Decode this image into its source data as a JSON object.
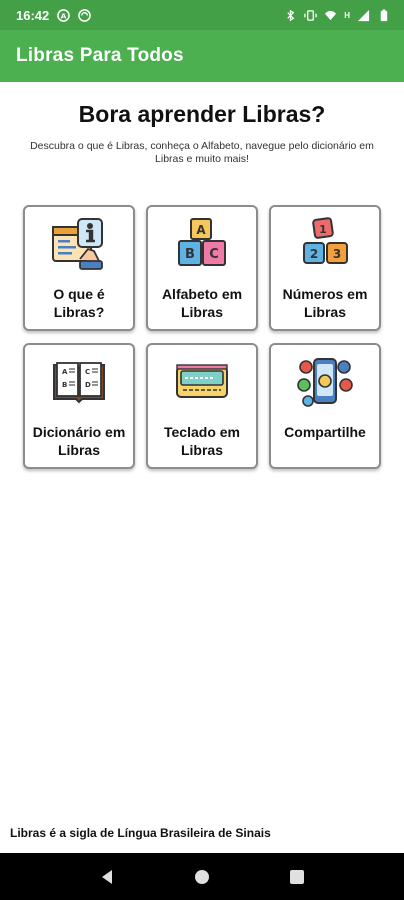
{
  "status_bar": {
    "time": "16:42",
    "icons": [
      "notification-icon",
      "sync-icon",
      "bluetooth-icon",
      "vibrate-icon",
      "wifi-icon",
      "signal-icon",
      "battery-icon"
    ],
    "signal_label": "H"
  },
  "app_bar": {
    "title": "Libras Para Todos",
    "color": "#4caf50"
  },
  "hero": {
    "title": "Bora aprender Libras?",
    "subtitle": "Descubra o que é Libras, conheça o Alfabeto, navegue pelo dicionário em Libras e muito mais!"
  },
  "cards": [
    {
      "label": "O que é Libras?",
      "icon": "info-person-icon"
    },
    {
      "label": "Alfabeto em Libras",
      "icon": "abc-blocks-icon"
    },
    {
      "label": "Números em Libras",
      "icon": "number-blocks-icon"
    },
    {
      "label": "Dicionário em Libras",
      "icon": "dictionary-book-icon"
    },
    {
      "label": "Teclado em Libras",
      "icon": "keyboard-icon"
    },
    {
      "label": "Compartilhe",
      "icon": "share-phone-icon"
    }
  ],
  "footer": {
    "note": "Libras é a sigla de Língua Brasileira de Sinais"
  },
  "nav_bar": {
    "buttons": [
      "back-icon",
      "home-icon",
      "recents-icon"
    ]
  }
}
